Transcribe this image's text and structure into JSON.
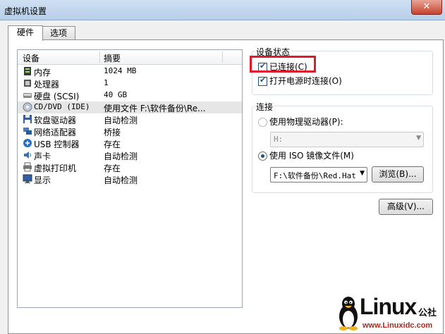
{
  "window": {
    "title": "虚拟机设置",
    "close_glyph": "✕"
  },
  "tabs": [
    {
      "label": "硬件",
      "active": true
    },
    {
      "label": "选项",
      "active": false
    }
  ],
  "devices": {
    "columns": [
      "设备",
      "摘要"
    ],
    "rows": [
      {
        "name": "内存",
        "summary": "1024 MB",
        "icon": "memory-icon"
      },
      {
        "name": "处理器",
        "summary": "1",
        "icon": "processor-icon"
      },
      {
        "name": "硬盘 (SCSI)",
        "summary": "40 GB",
        "icon": "hard-disk-icon"
      },
      {
        "name": "CD/DVD (IDE)",
        "summary": "使用文件 F:\\软件备份\\Re...",
        "icon": "cd-dvd-icon",
        "selected": true
      },
      {
        "name": "软盘驱动器",
        "summary": "自动检测",
        "icon": "floppy-icon"
      },
      {
        "name": "网络适配器",
        "summary": "桥接",
        "icon": "network-adapter-icon"
      },
      {
        "name": "USB 控制器",
        "summary": "存在",
        "icon": "usb-icon"
      },
      {
        "name": "声卡",
        "summary": "自动检测",
        "icon": "sound-card-icon"
      },
      {
        "name": "虚拟打印机",
        "summary": "存在",
        "icon": "printer-icon"
      },
      {
        "name": "显示",
        "summary": "自动检测",
        "icon": "display-icon"
      }
    ]
  },
  "device_status": {
    "legend": "设备状态",
    "connected": {
      "label": "已连接(C)",
      "checked": true
    },
    "connect_on_power": {
      "label": "打开电源时连接(O)",
      "checked": true
    }
  },
  "connection": {
    "legend": "连接",
    "physical": {
      "label": "使用物理驱动器(P):",
      "selected": false,
      "drive_value": "H:"
    },
    "iso": {
      "label": "使用 ISO 镜像文件(M)",
      "selected": true,
      "path_value": "F:\\软件备份\\Red.Hat"
    },
    "browse_label": "浏览(B)..."
  },
  "advanced_label": "高级(V)...",
  "watermark": {
    "brand": "Linux",
    "cn": "公社",
    "url": "www.Linuxidc.com"
  },
  "colors": {
    "highlight": "#e0192b",
    "accent": "#1c5180"
  }
}
